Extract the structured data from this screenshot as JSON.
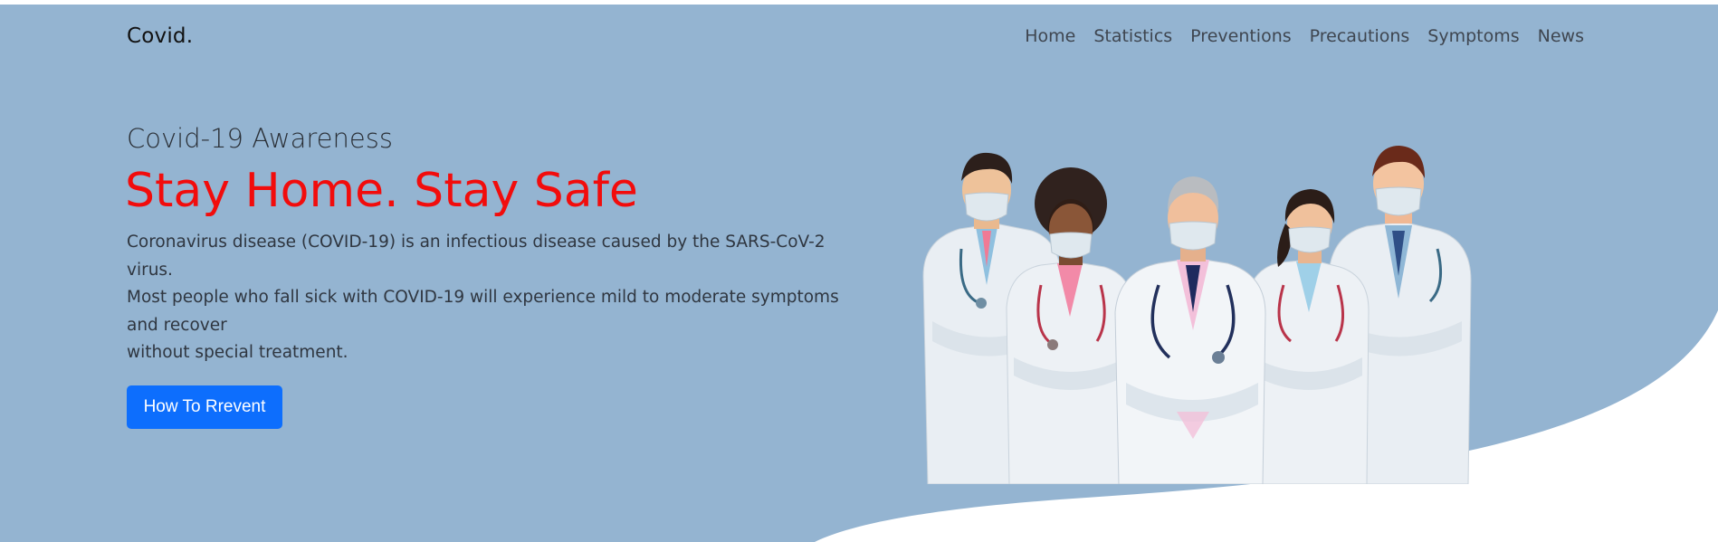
{
  "brand": "Covid.",
  "nav": {
    "items": [
      "Home",
      "Statistics",
      "Preventions",
      "Precautions",
      "Symptoms",
      "News"
    ]
  },
  "hero": {
    "subtitle": "Covid-19 Awareness",
    "headline": "Stay Home. Stay Safe",
    "description": [
      "Coronavirus disease (COVID-19) is an infectious disease caused by the SARS-CoV-2 virus.",
      "Most people who fall sick with COVID-19 will experience mild to moderate symptoms and recover",
      "without special treatment."
    ],
    "cta_label": "How To Rrevent"
  },
  "colors": {
    "hero_background": "#94b4d1",
    "headline": "#f20c0c",
    "button": "#0d6efd"
  }
}
